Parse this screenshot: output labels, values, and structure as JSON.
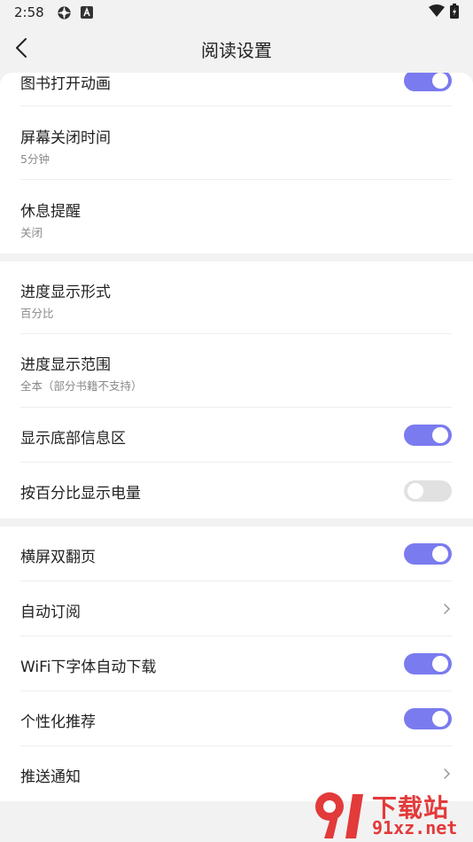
{
  "status_bar": {
    "time": "2:58",
    "icons": [
      "settings-gear-icon",
      "a-badge-icon",
      "wifi-icon",
      "battery-charging-icon"
    ]
  },
  "app_bar": {
    "title": "阅读设置",
    "back_icon": "chevron-left-icon"
  },
  "sections": [
    {
      "items": [
        {
          "label": "图书打开动画",
          "toggle": true
        },
        {
          "label": "屏幕关闭时间",
          "sub": "5分钟"
        },
        {
          "label": "休息提醒",
          "sub": "关闭"
        }
      ]
    },
    {
      "items": [
        {
          "label": "进度显示形式",
          "sub": "百分比"
        },
        {
          "label": "进度显示范围",
          "sub": "全本（部分书籍不支持）"
        },
        {
          "label": "显示底部信息区",
          "toggle": true
        },
        {
          "label": "按百分比显示电量",
          "toggle": false
        }
      ]
    },
    {
      "items": [
        {
          "label": "横屏双翻页",
          "toggle": true
        },
        {
          "label": "自动订阅",
          "chevron": true
        },
        {
          "label": "WiFi下字体自动下载",
          "toggle": true
        },
        {
          "label": "个性化推荐",
          "toggle": true
        },
        {
          "label": "推送通知",
          "chevron": true
        }
      ]
    }
  ],
  "watermark": {
    "line1": "下载站",
    "line2": "91xz.net"
  },
  "colors": {
    "toggle_on": "#7a7bef",
    "toggle_off": "#e1e1e1",
    "background": "#f2f2f2",
    "watermark": "#e33a3a"
  }
}
